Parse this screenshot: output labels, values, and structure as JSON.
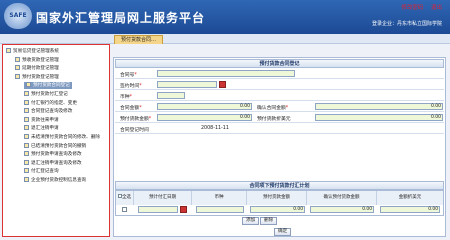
{
  "header": {
    "logo_text": "SAFE",
    "title": "国家外汇管理局网上服务平台",
    "link_password": "修改密码",
    "link_logout": "退出",
    "company_label": "登录企业：丹东市私立国际学院"
  },
  "tab": {
    "label": "预付货款合同…"
  },
  "sidebar": {
    "items": [
      {
        "label": "贸易信贷登记管理系统",
        "level": 0
      },
      {
        "label": "预收货款登记管理",
        "level": 1
      },
      {
        "label": "延期付款登记管理",
        "level": 1
      },
      {
        "label": "预付货款登记管理",
        "level": 1
      },
      {
        "label": "预付货款合同登记",
        "level": 2,
        "selected": true
      },
      {
        "label": "预付货款付汇登记",
        "level": 2
      },
      {
        "label": "付汇银行的指定、变更",
        "level": 2
      },
      {
        "label": "合同登记查询及修改",
        "level": 2
      },
      {
        "label": "货款往来申请",
        "level": 2
      },
      {
        "label": "退汇注销申请",
        "level": 2
      },
      {
        "label": "未结清预付货款合同的修改、删除",
        "level": 2
      },
      {
        "label": "已结清预付货款合同的撤销",
        "level": 2
      },
      {
        "label": "预付货款申请查询及修改",
        "level": 2
      },
      {
        "label": "退汇注销申请查询及修改",
        "level": 2
      },
      {
        "label": "付汇登记查询",
        "level": 2
      },
      {
        "label": "企业预付货款控制信息查询",
        "level": 2
      }
    ]
  },
  "form": {
    "title": "预付货款合同登记",
    "contract_no_label": "合同号",
    "sign_time_label": "签约时间",
    "currency_label": "币种",
    "amount_label": "合同金额",
    "confirm_amount_label": "确认合同金额",
    "amount_value": "0.00",
    "confirm_amount_value": "0.00",
    "prepay_label": "预付货款金额",
    "usd_label": "预付货款折美元",
    "prepay_value": "0.00",
    "usd_value": "0.00",
    "reg_time_label": "合同登记时间",
    "reg_time_value": "2008-11-11"
  },
  "plan": {
    "title": "合同项下预付货款付汇计划",
    "headers": [
      "全选",
      "预计付汇日期",
      "币种",
      "预付货款金额",
      "确认预付货款金额",
      "金额折美元"
    ],
    "row_values": [
      "0.00",
      "0.00",
      "0.00"
    ],
    "add_label": "添加",
    "delete_label": "删除",
    "confirm_label": "确定"
  }
}
